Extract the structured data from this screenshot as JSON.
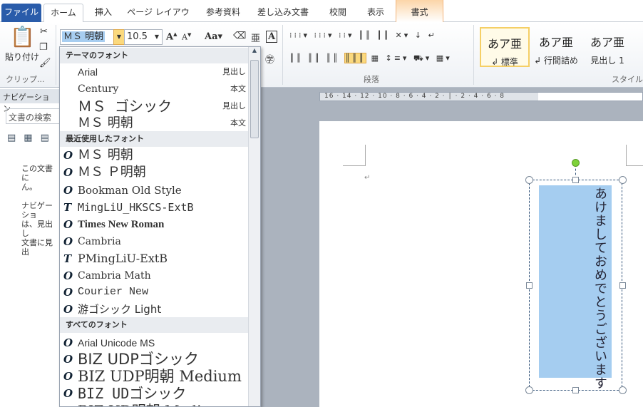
{
  "tabs": [
    {
      "label": "ファイル"
    },
    {
      "label": "ホーム"
    },
    {
      "label": "挿入"
    },
    {
      "label": "ページ レイアウト"
    },
    {
      "label": "参考資料"
    },
    {
      "label": "差し込み文書"
    },
    {
      "label": "校閲"
    },
    {
      "label": "表示"
    },
    {
      "label": "書式"
    }
  ],
  "ribbon": {
    "clipboard": {
      "paste_label": "貼り付け",
      "group_label": "クリップ..."
    },
    "font": {
      "name": "ＭＳ 明朝",
      "size": "10.5"
    },
    "paragraph": {
      "group_label": "段落"
    },
    "styles": {
      "group_label": "スタイル",
      "items": [
        {
          "preview": "あア亜",
          "label": "↲ 標準",
          "selected": true
        },
        {
          "preview": "あア亜",
          "label": "↲ 行間詰め"
        },
        {
          "preview": "あア亜",
          "label": "見出し 1"
        }
      ]
    }
  },
  "nav": {
    "title": "ナビゲーション",
    "search_placeholder": "文書の検索",
    "msg1": "この文書に",
    "msg1b": "ん。",
    "msg2": "ナビゲーショ",
    "msg2b": "は、見出し",
    "msg2c": "文書に見出"
  },
  "font_dropdown": {
    "sections": [
      {
        "header": "テーマのフォント",
        "items": [
          {
            "name": "Arial",
            "tag": "見出し"
          },
          {
            "name": "Century",
            "tag": "本文"
          },
          {
            "name": "ＭＳ ゴシック",
            "tag": "見出し"
          },
          {
            "name": "ＭＳ 明朝",
            "tag": "本文"
          }
        ]
      },
      {
        "header": "最近使用したフォント",
        "items": [
          {
            "name": "ＭＳ 明朝",
            "type": "O"
          },
          {
            "name": "ＭＳ Ｐ明朝",
            "type": "O"
          },
          {
            "name": "Bookman Old Style",
            "type": "O"
          },
          {
            "name": "MingLiU_HKSCS-ExtB",
            "type": "T"
          },
          {
            "name": "Times New Roman",
            "type": "O"
          },
          {
            "name": "Cambria",
            "type": "O"
          },
          {
            "name": "PMingLiU-ExtB",
            "type": "T"
          },
          {
            "name": "Cambria Math",
            "type": "O"
          },
          {
            "name": "Courier New",
            "type": "O"
          },
          {
            "name": "游ゴシック Light",
            "type": "O"
          }
        ]
      },
      {
        "header": "すべてのフォント",
        "items": [
          {
            "name": "Arial Unicode MS",
            "type": "O"
          },
          {
            "name": "BIZ UDPゴシック",
            "type": "O"
          },
          {
            "name": "BIZ UDP明朝 Medium",
            "type": "O"
          },
          {
            "name": "BIZ UDゴシック",
            "type": "O"
          },
          {
            "name": "BIZ UD明朝 Medium",
            "type": "O"
          }
        ]
      }
    ]
  },
  "ruler": {
    "labels": "16 · 14 · 12 · 10 · 8 · 6 · 4 · 2 · │ · 2 · 4 · 6 · 8"
  },
  "document": {
    "textbox_text": "あけましておめでとうございます",
    "paragraph_mark": "↵"
  },
  "colors": {
    "file_tab": "#2a5caa",
    "selection": "#a5cdf0",
    "context_tab": "#fcd5a8",
    "highlight": "#fbd97d"
  }
}
